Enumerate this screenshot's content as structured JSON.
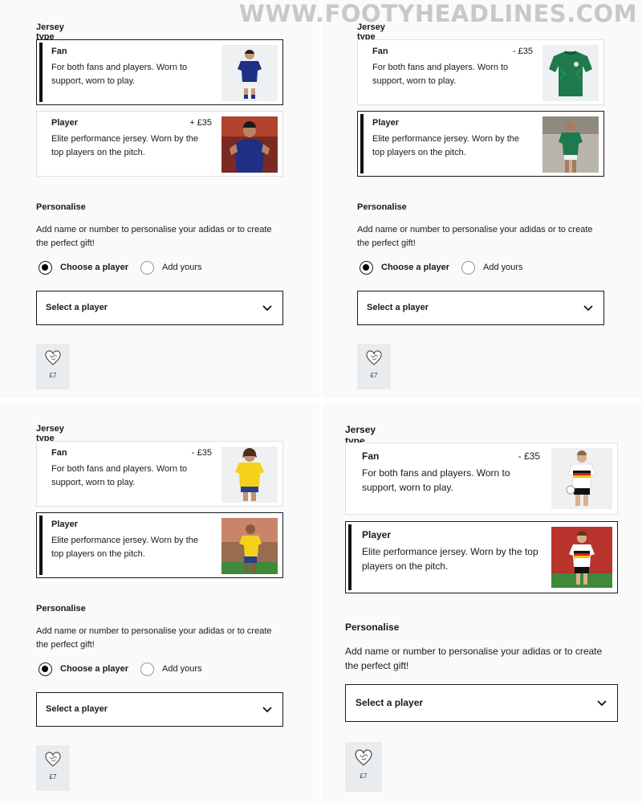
{
  "watermark": "WWW.FOOTYHEADLINES.COM",
  "colors": {
    "page_bg": "#fafafa",
    "card_bg": "#ffffff",
    "selected_border": "#1a1a1a",
    "tile_bg": "#e9ecef",
    "text": "#1a1a1a"
  },
  "panels": [
    {
      "jersey_type_title": "Jersey type",
      "options": [
        {
          "name": "Fan",
          "price": "",
          "desc": "For both fans and players. Worn to support, worn to play.",
          "selected": true,
          "image": "japan-fan-jersey-photo"
        },
        {
          "name": "Player",
          "price": "+ £35",
          "desc": "Elite performance jersey. Worn by the top players on the pitch.",
          "selected": false,
          "image": "japan-player-jersey-photo"
        }
      ],
      "personalise_title": "Personalise",
      "personalise_desc": "Add name or number to personalise your adidas or to create the perfect gift!",
      "radios": [
        {
          "label": "Choose a player",
          "checked": true
        },
        {
          "label": "Add yours",
          "checked": false
        }
      ],
      "select_label": "Select a player",
      "ball_price": "£7"
    },
    {
      "jersey_type_title": "Jersey type",
      "options": [
        {
          "name": "Fan",
          "price": "- £35",
          "desc": "For both fans and players. Worn to support, worn to play.",
          "selected": false,
          "image": "mexico-fan-jersey-photo"
        },
        {
          "name": "Player",
          "price": "",
          "desc": "Elite performance jersey. Worn by the top players on the pitch.",
          "selected": true,
          "image": "mexico-player-jersey-photo"
        }
      ],
      "personalise_title": "Personalise",
      "personalise_desc": "Add name or number to personalise your adidas or to create the perfect gift!",
      "radios": [
        {
          "label": "Choose a player",
          "checked": true
        },
        {
          "label": "Add yours",
          "checked": false
        }
      ],
      "select_label": "Select a player",
      "ball_price": "£7"
    },
    {
      "jersey_type_title": "Jersey type",
      "options": [
        {
          "name": "Fan",
          "price": "- £35",
          "desc": "For both fans and players. Worn to support, worn to play.",
          "selected": false,
          "image": "colombia-fan-jersey-photo"
        },
        {
          "name": "Player",
          "price": "",
          "desc": "Elite performance jersey. Worn by the top players on the pitch.",
          "selected": true,
          "image": "colombia-player-jersey-photo"
        }
      ],
      "personalise_title": "Personalise",
      "personalise_desc": "Add name or number to personalise your adidas or to create the perfect gift!",
      "radios": [
        {
          "label": "Choose a player",
          "checked": true
        },
        {
          "label": "Add yours",
          "checked": false
        }
      ],
      "select_label": "Select a player",
      "ball_price": "£7"
    },
    {
      "jersey_type_title": "Jersey type",
      "options": [
        {
          "name": "Fan",
          "price": "- £35",
          "desc": "For both fans and players. Worn to support, worn to play.",
          "selected": false,
          "image": "germany-fan-jersey-photo"
        },
        {
          "name": "Player",
          "price": "",
          "desc": "Elite performance jersey. Worn by the top players on the pitch.",
          "selected": true,
          "image": "germany-player-jersey-photo"
        }
      ],
      "personalise_title": "Personalise",
      "personalise_desc": "Add name or number to personalise your adidas or to create the perfect gift!",
      "select_label": "Select a player",
      "ball_price": "£7"
    }
  ]
}
